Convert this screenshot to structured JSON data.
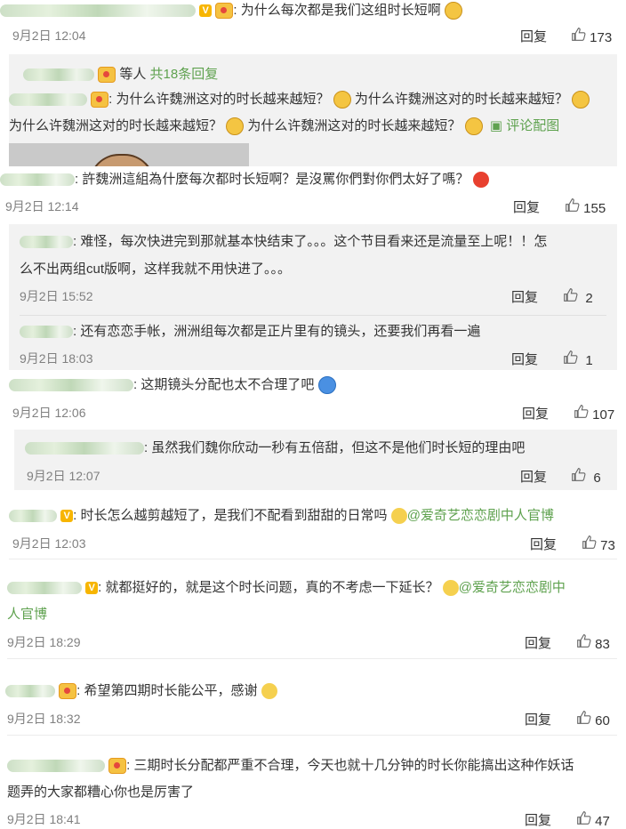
{
  "comments": [
    {
      "text": "为什么每次都是我们这组时长短啊",
      "date": "9月2日 12:04",
      "reply": "回复",
      "likes": "173"
    },
    {
      "text": "許魏洲這組為什麼每次都时长短啊？是沒罵你們對你們太好了嗎？",
      "date": "9月2日 12:14",
      "reply": "回复",
      "likes": "155"
    },
    {
      "text": "这期镜头分配也太不合理了吧",
      "date": "9月2日 12:06",
      "reply": "回复",
      "likes": "107"
    },
    {
      "text": "时长怎么越剪越短了，是我们不配看到甜甜的日常吗",
      "mention": "@爱奇艺恋恋剧中人官博",
      "date": "9月2日 12:03",
      "reply": "回复",
      "likes": "73"
    },
    {
      "text": "就都挺好的，就是这个时长问题，真的不考虑一下延长？",
      "mention": "@爱奇艺恋恋剧中",
      "mention2": "人官博",
      "date": "9月2日 18:29",
      "reply": "回复",
      "likes": "83"
    },
    {
      "text": "希望第四期时长能公平，感谢",
      "date": "9月2日 18:32",
      "reply": "回复",
      "likes": "60"
    },
    {
      "text": "三期时长分配都严重不合理，今天也就十几分钟的时长你能搞出这种作妖话",
      "text2": "题弄的大家都糟心你也是厉害了",
      "date": "9月2日 18:41",
      "reply": "回复",
      "likes": "47"
    }
  ],
  "thread1": {
    "others_label": "等人",
    "count_link": "共18条回复",
    "line1": "为什么许魏洲这对的时长越来越短？",
    "line1b": "为什么许魏洲这对的时长越来越短？",
    "line2a": "为什么许魏洲这对的时长越来越短？",
    "line2b": "为什么许魏洲这对的时长越来越短？",
    "pic_link": "评论配图"
  },
  "sub2": [
    {
      "text": "难怪，每次快进完到那就基本快结束了。。。这个节目看来还是流量至上呢！！怎",
      "text2": "么不出两组cut版啊，这样我就不用快进了。。。",
      "date": "9月2日 15:52",
      "reply": "回复",
      "likes": "2"
    },
    {
      "text": "还有恋恋手帐，洲洲组每次都是正片里有的镜头，还要我们再看一遍",
      "date": "9月2日 18:03",
      "reply": "回复",
      "likes": "1"
    }
  ],
  "sub3": [
    {
      "text": "虽然我们魏你欣动一秒有五倍甜，但这不是他们时长短的理由吧",
      "date": "9月2日 12:07",
      "reply": "回复",
      "likes": "6"
    }
  ],
  "colors": {
    "link": "#5fa24f",
    "meta": "#808080",
    "sub_bg": "#f2f2f2"
  }
}
